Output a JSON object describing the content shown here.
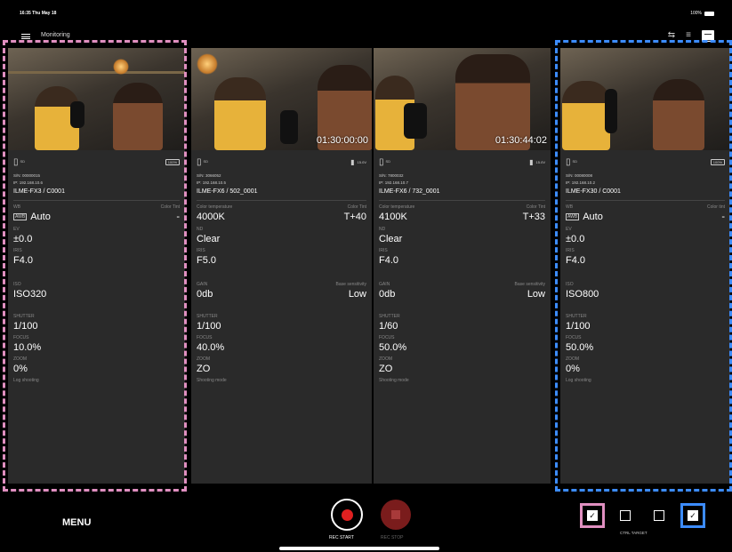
{
  "status": {
    "time": "16:35  Thu May 18",
    "battery": "100%"
  },
  "header": {
    "title": "Monitoring"
  },
  "panels": [
    {
      "timecode": "",
      "slot": "SD",
      "battery": "100%",
      "serial": "S/N: 00000015",
      "ip": "IP: 192.168.10.6",
      "model": "ILME-FX3 / C0001",
      "wb_label": "WB",
      "wb_right_label": "Color Tint",
      "wb_mode_icon": "AWB",
      "wb_value": "Auto",
      "wb_right_value": "-",
      "ev_label": "EV",
      "ev_value": "±0.0",
      "iris_label": "IRIS",
      "iris_value": "F4.0",
      "iso_label": "ISO",
      "iso_value": "ISO320",
      "shutter_label": "SHUTTER",
      "shutter_value": "1/100",
      "focus_label": "FOCUS",
      "focus_value": "10.0%",
      "zoom_label": "ZOOM",
      "zoom_value": "0%",
      "mode_label": "Log shooting"
    },
    {
      "timecode": "01:30:00:00",
      "slot": "SD",
      "battery": "15.0V",
      "serial": "S/N: 3066052",
      "ip": "IP: 192.168.10.5",
      "model": "ILME-FX6 / 502_0001",
      "wb_label": "Color temperature",
      "wb_right_label": "Color Tint",
      "wb_value": "4000K",
      "wb_right_value": "T+40",
      "ev_label": "ND",
      "ev_value": "Clear",
      "iris_label": "IRIS",
      "iris_value": "F5.0",
      "iso_label": "GAIN",
      "iso_right_label": "Base sensitivity",
      "iso_value": "0db",
      "iso_right_value": "Low",
      "shutter_label": "SHUTTER",
      "shutter_value": "1/100",
      "focus_label": "FOCUS",
      "focus_value": "40.0%",
      "zoom_label": "ZOOM",
      "zoom_value": "ZO",
      "mode_label": "Shooting mode"
    },
    {
      "timecode": "01:30:44:02",
      "slot": "SD",
      "battery": "15.0V",
      "serial": "S/N: 7800032",
      "ip": "IP: 192.168.10.7",
      "model": "ILME-FX6 / 732_0001",
      "wb_label": "Color temperature",
      "wb_right_label": "Color Tint",
      "wb_value": "4100K",
      "wb_right_value": "T+33",
      "ev_label": "ND",
      "ev_value": "Clear",
      "iris_label": "IRIS",
      "iris_value": "F4.0",
      "iso_label": "GAIN",
      "iso_right_label": "Base sensitivity",
      "iso_value": "0db",
      "iso_right_value": "Low",
      "shutter_label": "SHUTTER",
      "shutter_value": "1/60",
      "focus_label": "FOCUS",
      "focus_value": "50.0%",
      "zoom_label": "ZOOM",
      "zoom_value": "ZO",
      "mode_label": "Shooting mode"
    },
    {
      "timecode": "",
      "slot": "SD",
      "battery": "100%",
      "serial": "S/N: 00080008",
      "ip": "IP: 192.168.10.2",
      "model": "ILME-FX30 / C0001",
      "wb_label": "WB",
      "wb_right_label": "Color tint",
      "wb_mode_icon": "AWB",
      "wb_value": "Auto",
      "wb_right_value": "-",
      "ev_label": "EV",
      "ev_value": "±0.0",
      "iris_label": "IRIS",
      "iris_value": "F4.0",
      "iso_label": "ISO",
      "iso_value": "ISO800",
      "shutter_label": "SHUTTER",
      "shutter_value": "1/100",
      "focus_label": "FOCUS",
      "focus_value": "50.0%",
      "zoom_label": "ZOOM",
      "zoom_value": "0%",
      "mode_label": "Log shooting"
    }
  ],
  "bottom": {
    "menu_label": "MENU",
    "rec_start_label": "REC START",
    "rec_stop_label": "REC STOP",
    "ctrl_target_label": "CTRL TARGET",
    "check_mark": "✓"
  },
  "colors": {
    "highlight_pink": "#e08fc0",
    "highlight_blue": "#3c8cff",
    "rec_red": "#e02020"
  },
  "icons": [
    "hamburger-icon",
    "camera-switch-icon",
    "list-icon",
    "grid-icon",
    "sd-card-icon",
    "battery-icon",
    "record-icon",
    "stop-icon",
    "checkbox-icon"
  ]
}
